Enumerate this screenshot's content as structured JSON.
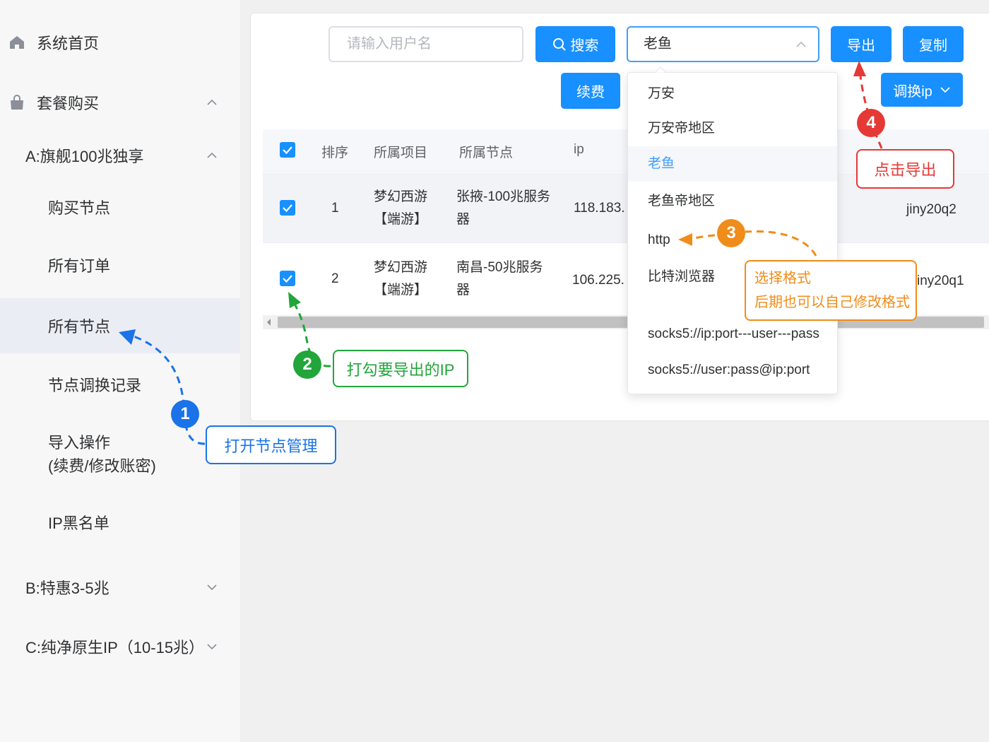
{
  "sidebar": {
    "home": "系统首页",
    "package": "套餐购买",
    "group_a": "A:旗舰100兆独享",
    "buy_node": "购买节点",
    "all_orders": "所有订单",
    "all_nodes": "所有节点",
    "node_swap_log": "节点调换记录",
    "import_line1": "导入操作",
    "import_line2": "(续费/修改账密)",
    "ip_blacklist": "IP黑名单",
    "group_b": "B:特惠3-5兆",
    "group_c": "C:纯净原生IP（10-15兆）"
  },
  "toolbar": {
    "search_placeholder": "请输入用户名",
    "search_label": "搜索",
    "select_value": "老鱼",
    "export_label": "导出",
    "copy_label": "复制",
    "renew_label": "续费",
    "swap_ip_label": "调换ip"
  },
  "table": {
    "headers": [
      "排序",
      "所属项目",
      "所属节点",
      "ip"
    ],
    "rows": [
      {
        "index": "1",
        "project_l1": "梦幻西游",
        "project_l2": "【端游】",
        "node_l1": "张掖-100兆服务",
        "node_l2": "器",
        "ip": "118.183.",
        "user": "jiny20q2"
      },
      {
        "index": "2",
        "project_l1": "梦幻西游",
        "project_l2": "【端游】",
        "node_l1": "南昌-50兆服务",
        "node_l2": "器",
        "ip": "106.225.",
        "user": "iny20q1"
      }
    ]
  },
  "dropdown": {
    "options": [
      "万安",
      "万安帝地区",
      "老鱼",
      "老鱼帝地区",
      "http",
      "比特浏览器",
      "socks5://ip:port---user---pass",
      "socks5://user:pass@ip:port"
    ],
    "selected": "老鱼"
  },
  "annotations": {
    "step1_num": "1",
    "step1_text": "打开节点管理",
    "step2_num": "2",
    "step2_text": "打勾要导出的IP",
    "step3_num": "3",
    "step3_line1": "选择格式",
    "step3_line2": "后期也可以自己修改格式",
    "step4_num": "4",
    "step4_text": "点击导出"
  },
  "colors": {
    "primary": "#1890ff",
    "step1": "#1a73e8",
    "step2": "#22a53a",
    "step3": "#f08c1a",
    "step4": "#e53935"
  }
}
